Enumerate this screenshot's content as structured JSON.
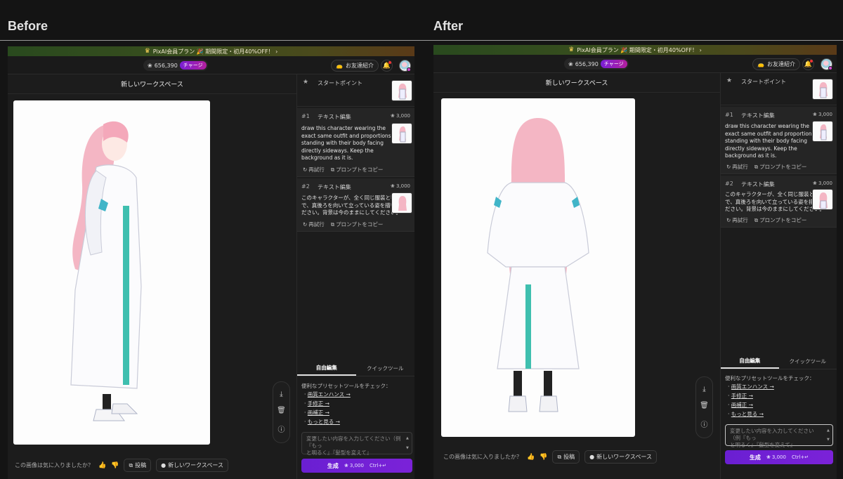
{
  "labels": {
    "before": "Before",
    "after": "After"
  },
  "banner": {
    "text": "PixAI会員プラン 🎉 期間限定・初月40%OFF！ ›"
  },
  "header": {
    "credits": "656,390",
    "charge": "チャージ",
    "invite": "お友達紹介"
  },
  "workspace_title": "新しいワークスペース",
  "history": {
    "start_point": "スタートポイント",
    "edits": [
      {
        "num": "#1",
        "type": "テキスト編集",
        "cost": "3,000",
        "prompt_lines": [
          "draw this character wearing the",
          "exact same outfit and proportions,",
          "standing with their body facing",
          "directly sideways. Keep the",
          "background as it is."
        ]
      },
      {
        "num": "#2",
        "type": "テキスト編集",
        "cost": "3,000",
        "prompt_lines": [
          "このキャラクターが、全く同じ服装と等身",
          "で、真後ろを向いて立っている姿を描いてく",
          "ださい。背景は今のままにしてください。"
        ]
      }
    ],
    "retry": "再試行",
    "copy_prompt": "プロンプトをコピー"
  },
  "tabs": {
    "free_edit": "自由編集",
    "quick_tool": "クイックツール"
  },
  "presets": {
    "title": "便利なプリセットツールをチェック：",
    "items": [
      "画質エンハンス →",
      "手修正 →",
      "画補正 →",
      "もっと見る →"
    ]
  },
  "input": {
    "line1": "変更したい内容を入力してください（例『もっ",
    "line2": "と明るく』『髪型を変えて』"
  },
  "generate": {
    "label": "生成",
    "cost": "3,000",
    "shortcut": "Ctrl+↵"
  },
  "feedback": {
    "question": "この画像は気に入りましたか？",
    "post": "投稿",
    "new_workspace": "新しいワークスペース"
  }
}
